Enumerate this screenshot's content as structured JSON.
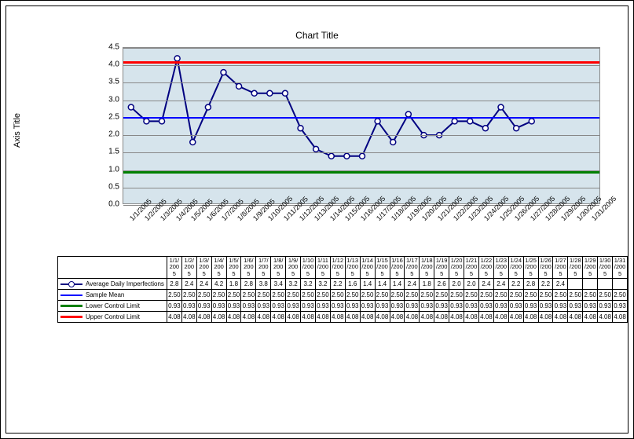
{
  "title": "Chart Title",
  "yaxis_title": "Axis Title",
  "chart_data": {
    "type": "line",
    "title": "Chart Title",
    "xlabel": "",
    "ylabel": "Axis Title",
    "ylim": [
      0.0,
      4.5
    ],
    "yticks": [
      0.0,
      0.5,
      1.0,
      1.5,
      2.0,
      2.5,
      3.0,
      3.5,
      4.0,
      4.5
    ],
    "categories": [
      "1/1/2005",
      "1/2/2005",
      "1/3/2005",
      "1/4/2005",
      "1/5/2005",
      "1/6/2005",
      "1/7/2005",
      "1/8/2005",
      "1/9/2005",
      "1/10/2005",
      "1/11/2005",
      "1/12/2005",
      "1/13/2005",
      "1/14/2005",
      "1/15/2005",
      "1/16/2005",
      "1/17/2005",
      "1/18/2005",
      "1/19/2005",
      "1/20/2005",
      "1/21/2005",
      "1/22/2005",
      "1/23/2005",
      "1/24/2005",
      "1/25/2005",
      "1/26/2005",
      "1/27/2005",
      "1/28/2005",
      "1/29/2005",
      "1/30/2005",
      "1/31/2005"
    ],
    "series": [
      {
        "name": "Average Daily Imperfections",
        "values": [
          2.8,
          2.4,
          2.4,
          4.2,
          1.8,
          2.8,
          3.8,
          3.4,
          3.2,
          3.2,
          3.2,
          2.2,
          1.6,
          1.4,
          1.4,
          1.4,
          2.4,
          1.8,
          2.6,
          2.0,
          2.0,
          2.4,
          2.4,
          2.2,
          2.8,
          2.2,
          2.4,
          null,
          null,
          null,
          null
        ]
      },
      {
        "name": "Sample Mean",
        "values": [
          2.5,
          2.5,
          2.5,
          2.5,
          2.5,
          2.5,
          2.5,
          2.5,
          2.5,
          2.5,
          2.5,
          2.5,
          2.5,
          2.5,
          2.5,
          2.5,
          2.5,
          2.5,
          2.5,
          2.5,
          2.5,
          2.5,
          2.5,
          2.5,
          2.5,
          2.5,
          2.5,
          2.5,
          2.5,
          2.5,
          2.5
        ]
      },
      {
        "name": "Lower Control Limit",
        "values": [
          0.93,
          0.93,
          0.93,
          0.93,
          0.93,
          0.93,
          0.93,
          0.93,
          0.93,
          0.93,
          0.93,
          0.93,
          0.93,
          0.93,
          0.93,
          0.93,
          0.93,
          0.93,
          0.93,
          0.93,
          0.93,
          0.93,
          0.93,
          0.93,
          0.93,
          0.93,
          0.93,
          0.93,
          0.93,
          0.93,
          0.93
        ]
      },
      {
        "name": "Upper Control Limit",
        "values": [
          4.08,
          4.08,
          4.08,
          4.08,
          4.08,
          4.08,
          4.08,
          4.08,
          4.08,
          4.08,
          4.08,
          4.08,
          4.08,
          4.08,
          4.08,
          4.08,
          4.08,
          4.08,
          4.08,
          4.08,
          4.08,
          4.08,
          4.08,
          4.08,
          4.08,
          4.08,
          4.08,
          4.08,
          4.08,
          4.08,
          4.08
        ]
      }
    ],
    "table_header_top": [
      "1/1/",
      "1/2/",
      "1/3/",
      "1/4/",
      "1/5/",
      "1/6/",
      "1/7/",
      "1/8/",
      "1/9/",
      "1/10",
      "1/11",
      "1/12",
      "1/13",
      "1/14",
      "1/15",
      "1/16",
      "1/17",
      "1/18",
      "1/19",
      "1/20",
      "1/21",
      "1/22",
      "1/23",
      "1/24",
      "1/25",
      "1/26",
      "1/27",
      "1/28",
      "1/29",
      "1/30",
      "1/31"
    ],
    "table_header_mid": [
      "200",
      "200",
      "200",
      "200",
      "200",
      "200",
      "200",
      "200",
      "200",
      "/200",
      "/200",
      "/200",
      "/200",
      "/200",
      "/200",
      "/200",
      "/200",
      "/200",
      "/200",
      "/200",
      "/200",
      "/200",
      "/200",
      "/200",
      "/200",
      "/200",
      "/200",
      "/200",
      "/200",
      "/200",
      "/200"
    ],
    "table_header_bot": [
      "5",
      "5",
      "5",
      "5",
      "5",
      "5",
      "5",
      "5",
      "5",
      "5",
      "5",
      "5",
      "5",
      "5",
      "5",
      "5",
      "5",
      "5",
      "5",
      "5",
      "5",
      "5",
      "5",
      "5",
      "5",
      "5",
      "5",
      "5",
      "5",
      "5",
      "5"
    ],
    "table_row1_label": "Average Daily Imperfections",
    "table_row1": [
      "2.8",
      "2.4",
      "2.4",
      "4.2",
      "1.8",
      "2.8",
      "3.8",
      "3.4",
      "3.2",
      "3.2",
      "3.2",
      "2.2",
      "1.6",
      "1.4",
      "1.4",
      "1.4",
      "2.4",
      "1.8",
      "2.6",
      "2.0",
      "2.0",
      "2.4",
      "2.4",
      "2.2",
      "2.8",
      "2.2",
      "2.4",
      "",
      "",
      "",
      ""
    ],
    "table_row2_label": "Sample Mean",
    "table_row2": [
      "2.50",
      "2.50",
      "2.50",
      "2.50",
      "2.50",
      "2.50",
      "2.50",
      "2.50",
      "2.50",
      "2.50",
      "2.50",
      "2.50",
      "2.50",
      "2.50",
      "2.50",
      "2.50",
      "2.50",
      "2.50",
      "2.50",
      "2.50",
      "2.50",
      "2.50",
      "2.50",
      "2.50",
      "2.50",
      "2.50",
      "2.50",
      "2.50",
      "2.50",
      "2.50",
      "2.50"
    ],
    "table_row3_label": "Lower Control Limit",
    "table_row3": [
      "0.93",
      "0.93",
      "0.93",
      "0.93",
      "0.93",
      "0.93",
      "0.93",
      "0.93",
      "0.93",
      "0.93",
      "0.93",
      "0.93",
      "0.93",
      "0.93",
      "0.93",
      "0.93",
      "0.93",
      "0.93",
      "0.93",
      "0.93",
      "0.93",
      "0.93",
      "0.93",
      "0.93",
      "0.93",
      "0.93",
      "0.93",
      "0.93",
      "0.93",
      "0.93",
      "0.93"
    ],
    "table_row4_label": "Upper Control Limit",
    "table_row4": [
      "4.08",
      "4.08",
      "4.08",
      "4.08",
      "4.08",
      "4.08",
      "4.08",
      "4.08",
      "4.08",
      "4.08",
      "4.08",
      "4.08",
      "4.08",
      "4.08",
      "4.08",
      "4.08",
      "4.08",
      "4.08",
      "4.08",
      "4.08",
      "4.08",
      "4.08",
      "4.08",
      "4.08",
      "4.08",
      "4.08",
      "4.08",
      "4.08",
      "4.08",
      "4.08",
      "4.08"
    ]
  }
}
